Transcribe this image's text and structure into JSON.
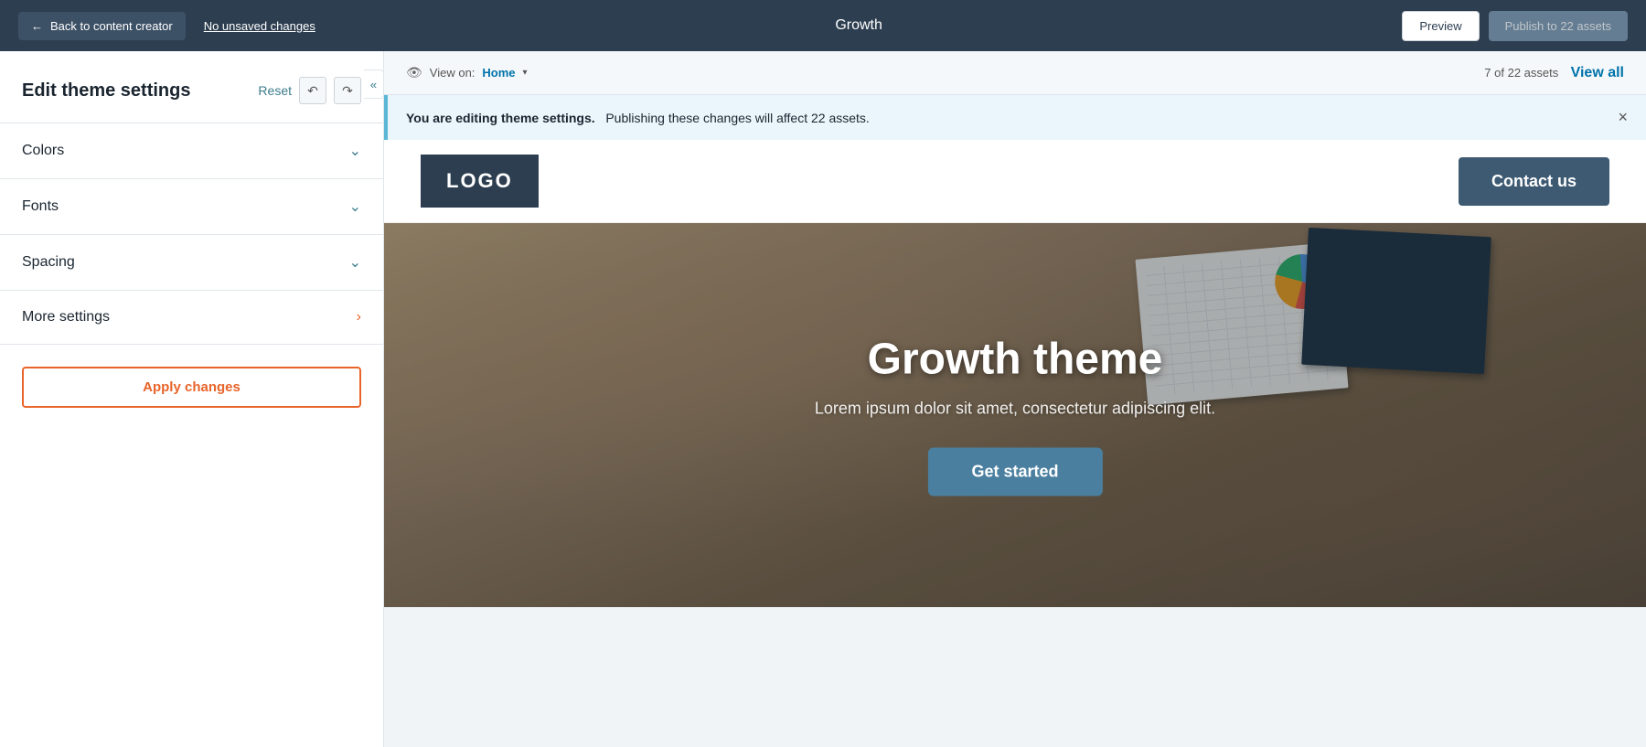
{
  "topbar": {
    "back_label": "Back to content creator",
    "unsaved_label": "No unsaved changes",
    "title": "Growth",
    "preview_label": "Preview",
    "publish_label": "Publish to 22 assets"
  },
  "sidebar": {
    "title": "Edit theme settings",
    "reset_label": "Reset",
    "collapse_icon": "«",
    "sections": [
      {
        "id": "colors",
        "label": "Colors",
        "chevron": "down"
      },
      {
        "id": "fonts",
        "label": "Fonts",
        "chevron": "down"
      },
      {
        "id": "spacing",
        "label": "Spacing",
        "chevron": "down"
      },
      {
        "id": "more-settings",
        "label": "More settings",
        "chevron": "right"
      }
    ],
    "apply_label": "Apply changes"
  },
  "sub_header": {
    "eye_icon": "👁",
    "view_on_label": "View on:",
    "page_label": "Home",
    "dropdown_arrow": "▾",
    "assets_label": "7 of 22 assets",
    "view_all_label": "View all"
  },
  "alert": {
    "bold_text": "You are editing theme settings.",
    "body_text": "Publishing these changes will affect 22 assets.",
    "close_icon": "×"
  },
  "preview": {
    "logo_text": "LOGO",
    "contact_label": "Contact us",
    "hero_title": "Growth theme",
    "hero_subtitle": "Lorem ipsum dolor sit amet, consectetur adipiscing elit.",
    "get_started_label": "Get started"
  }
}
